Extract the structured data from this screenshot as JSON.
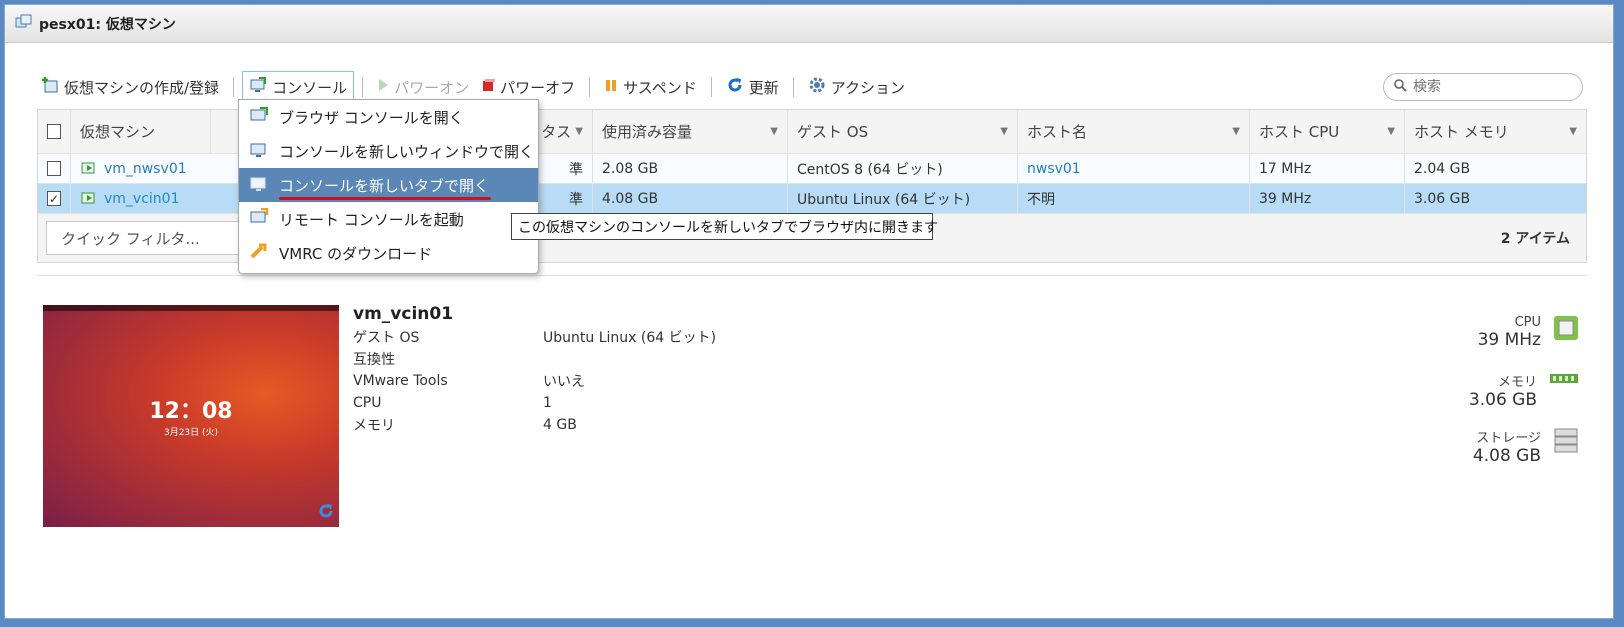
{
  "window": {
    "title": "pesx01: 仮想マシン"
  },
  "toolbar": {
    "create": "仮想マシンの作成/登録",
    "console": "コンソール",
    "power_on": "パワーオン",
    "power_off": "パワーオフ",
    "suspend": "サスペンド",
    "refresh": "更新",
    "actions": "アクション",
    "search_placeholder": "検索"
  },
  "console_menu": {
    "items": [
      {
        "label": "ブラウザ コンソールを開く"
      },
      {
        "label": "コンソールを新しいウィンドウで開く"
      },
      {
        "label": "コンソールを新しいタブで開く"
      },
      {
        "label": "リモート コンソールを起動"
      },
      {
        "label": "VMRC のダウンロード"
      }
    ],
    "tooltip": "この仮想マシンのコンソールを新しいタブでブラウザ内に開きます"
  },
  "table": {
    "columns": [
      "仮想マシン",
      "タス",
      "使用済み容量",
      "ゲスト OS",
      "ホスト名",
      "ホスト CPU",
      "ホスト メモリ"
    ],
    "rows": [
      {
        "selected": false,
        "name": "vm_nwsv01",
        "status": "準",
        "used": "2.08 GB",
        "guest_os": "CentOS 8 (64 ビット)",
        "host": "nwsv01",
        "cpu": "17 MHz",
        "memory": "2.04 GB"
      },
      {
        "selected": true,
        "name": "vm_vcin01",
        "status": "準",
        "used": "4.08 GB",
        "guest_os": "Ubuntu Linux (64 ビット)",
        "host": "不明",
        "cpu": "39 MHz",
        "memory": "3.06 GB"
      }
    ],
    "quick_filter": "クイック フィルタ...",
    "item_count": "2 アイテム"
  },
  "detail": {
    "vm_name": "vm_vcin01",
    "thumbnail": {
      "time": "12：08",
      "date": "3月23日 (火)"
    },
    "props": [
      {
        "key": "ゲスト OS",
        "value": "Ubuntu Linux (64 ビット)"
      },
      {
        "key": "互換性",
        "value": ""
      },
      {
        "key": "VMware Tools",
        "value": "いいえ"
      },
      {
        "key": "CPU",
        "value": "1"
      },
      {
        "key": "メモリ",
        "value": "4 GB"
      }
    ],
    "resources": [
      {
        "label": "CPU",
        "value": "39 MHz",
        "icon": "cpu-icon"
      },
      {
        "label": "メモリ",
        "value": "3.06 GB",
        "icon": "memory-icon"
      },
      {
        "label": "ストレージ",
        "value": "4.08 GB",
        "icon": "storage-icon"
      }
    ]
  }
}
